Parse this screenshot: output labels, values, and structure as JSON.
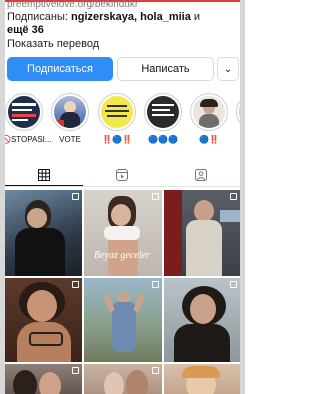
{
  "bio": {
    "link_text": "preemptivelove.org/bekindukr"
  },
  "followers": {
    "prefix": "Подписаны: ",
    "names": "ngizerskaya, hola_miia",
    "connector": " и",
    "more": "ещё 36"
  },
  "translate_label": "Показать перевод",
  "actions": {
    "follow_label": "Подписаться",
    "message_label": "Написать",
    "more_glyph": "⌄"
  },
  "highlights": [
    {
      "label": "🚫STOPASI..."
    },
    {
      "label": "VOTE"
    },
    {
      "label": "‼️🔵‼️"
    },
    {
      "label": "🔵🔵🔵"
    },
    {
      "label": "🔵‼️"
    },
    {
      "label": "💗"
    }
  ],
  "tabs": [
    {
      "name": "grid",
      "icon": "grid-icon"
    },
    {
      "name": "reels",
      "icon": "reels-icon"
    },
    {
      "name": "tagged",
      "icon": "tagged-icon"
    }
  ],
  "grid_posts": [
    {
      "poster_text": ""
    },
    {
      "poster_text": "Beyaz geceler"
    },
    {
      "poster_text": ""
    },
    {
      "poster_text": ""
    },
    {
      "poster_text": ""
    },
    {
      "poster_text": ""
    },
    {
      "poster_text": ""
    },
    {
      "poster_text": ""
    },
    {
      "poster_text": ""
    }
  ],
  "colors": {
    "follow_button": "#2f8df5",
    "accent_red": "#e23b3b"
  }
}
